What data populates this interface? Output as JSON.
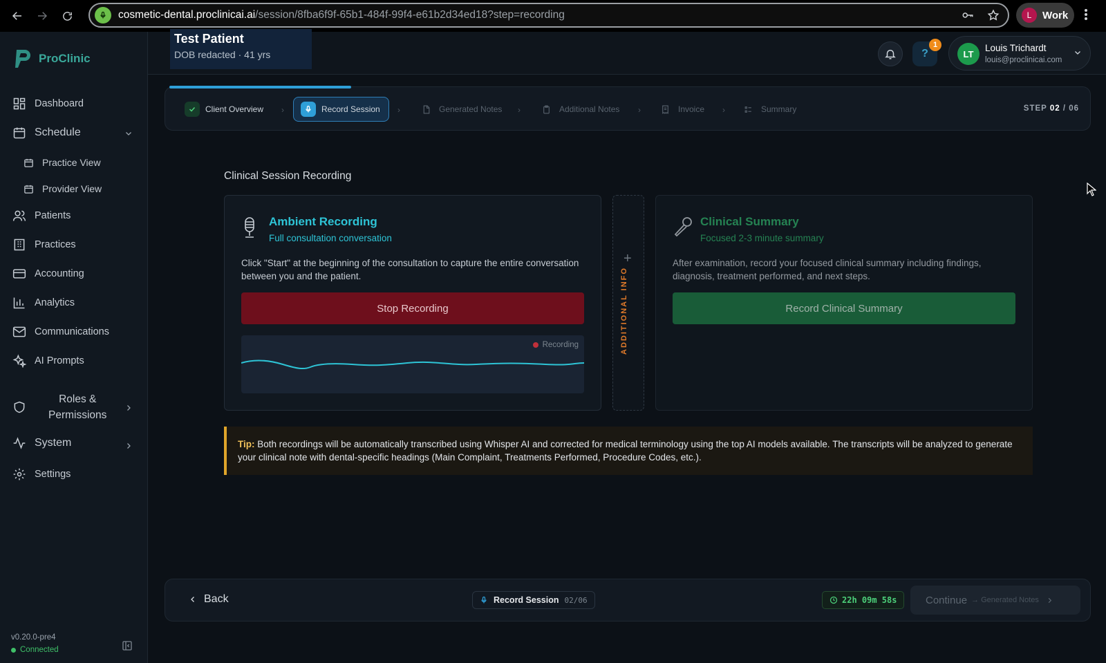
{
  "browser": {
    "url_host": "cosmetic-dental.proclinicai.ai",
    "url_path": "/session/8fba6f9f-65b1-484f-99f4-e61b2d34ed18?step=recording",
    "profile_initial": "L",
    "profile_label": "Work"
  },
  "sidebar": {
    "logo_text": "ProClinic",
    "items": [
      {
        "label": "Dashboard"
      },
      {
        "label": "Schedule"
      },
      {
        "label": "Practice View"
      },
      {
        "label": "Provider View"
      },
      {
        "label": "Patients"
      },
      {
        "label": "Practices"
      },
      {
        "label": "Accounting"
      },
      {
        "label": "Analytics"
      },
      {
        "label": "Communications"
      },
      {
        "label": "AI Prompts"
      },
      {
        "label": "Roles &"
      },
      {
        "label": "Permissions"
      },
      {
        "label": "System"
      },
      {
        "label": "Settings"
      }
    ],
    "version": "v0.20.0-pre4",
    "status": "Connected"
  },
  "patient": {
    "name": "Test Patient",
    "dob": "DOB redacted",
    "sep": "·",
    "age": "41 yrs"
  },
  "header": {
    "help_badge": "1",
    "help_glyph": "?",
    "user_initials": "LT",
    "user_name": "Louis Trichardt",
    "user_email": "louis@proclinicai.com"
  },
  "stepper": {
    "progress_fraction": 0.333,
    "steps": [
      {
        "label": "Client Overview",
        "state": "done"
      },
      {
        "label": "Record Session",
        "state": "active"
      },
      {
        "label": "Generated Notes",
        "state": "pending"
      },
      {
        "label": "Additional Notes",
        "state": "pending"
      },
      {
        "label": "Invoice",
        "state": "pending"
      },
      {
        "label": "Summary",
        "state": "pending"
      }
    ],
    "step_prefix": "STEP",
    "step_current": "02",
    "step_total": "/ 06"
  },
  "main": {
    "heading": "Clinical Session Recording",
    "ambient": {
      "title": "Ambient Recording",
      "subtitle": "Full consultation conversation",
      "description": "Click \"Start\" at the beginning of the consultation to capture the entire conversation between you and the patient.",
      "button": "Stop Recording",
      "recording_label": "Recording"
    },
    "additional": {
      "plus": "+",
      "label": "ADDITIONAL INFO"
    },
    "clinical": {
      "title": "Clinical Summary",
      "subtitle": "Focused 2-3 minute summary",
      "description": "After examination, record your focused clinical summary including findings, diagnosis, treatment performed, and next steps.",
      "button": "Record Clinical Summary"
    },
    "tip": {
      "label": "Tip:",
      "text": "Both recordings will be automatically transcribed using Whisper AI and corrected for medical terminology using the top AI models available. The transcripts will be analyzed to generate your clinical note with dental-specific headings (Main Complaint, Treatments Performed, Procedure Codes, etc.)."
    }
  },
  "footer": {
    "back": "Back",
    "step_label": "Record Session",
    "step_count": "02/06",
    "timer": "22h 09m 58s",
    "continue": "Continue",
    "continue_sub": "→ Generated Notes"
  },
  "colors": {
    "accent_teal": "#2ec4d6",
    "clinical_green": "#1e7a46",
    "stop_red": "#6e0f1c",
    "tip_yellow": "#e0a52a"
  }
}
